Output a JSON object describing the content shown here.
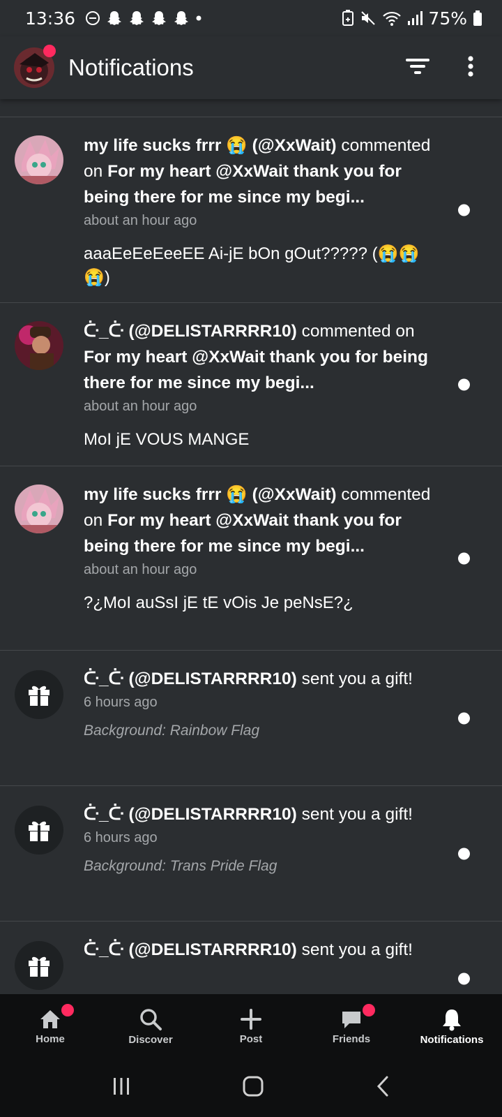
{
  "status_bar": {
    "time": "13:36",
    "battery": "75%",
    "icons": [
      "dnd-icon",
      "snapchat-icon",
      "snapchat-icon",
      "snapchat-icon",
      "snapchat-icon",
      "dot-icon",
      "battery-saver-icon",
      "mute-icon",
      "wifi-icon",
      "signal-icon",
      "battery-icon"
    ]
  },
  "header": {
    "title": "Notifications",
    "filter_icon": "filter-icon",
    "more_icon": "more-vertical-icon"
  },
  "notifications": [
    {
      "type": "comment",
      "user": "my life sucks frrr 😭 (@XxWait)",
      "action": "commented on",
      "target": "For my heart @XxWait thank you for being there for me since my begi...",
      "time": "about an hour ago",
      "content": "aaaEeEeEeeEE Ai-jE bOn gOut????? (😭😭😭)"
    },
    {
      "type": "comment",
      "user": "ᑤ_ᑤ (@DELISTARRRR10)",
      "action": "commented on",
      "target": "For my heart @XxWait thank you for being there for me since my begi...",
      "time": "about an hour ago",
      "content": "MoI jE VOUS MANGE"
    },
    {
      "type": "comment",
      "user": "my life sucks frrr 😭 (@XxWait)",
      "action": "commented on",
      "target": "For my heart @XxWait thank you for being there for me since my begi...",
      "time": "about an hour ago",
      "content": "?¿MoI auSsI jE tE vOis Je peNsE?¿"
    },
    {
      "type": "gift",
      "user": "ᑤ_ᑤ (@DELISTARRRR10)",
      "action": "sent you a gift!",
      "time": "6 hours ago",
      "content": "Background: Rainbow Flag"
    },
    {
      "type": "gift",
      "user": "ᑤ_ᑤ (@DELISTARRRR10)",
      "action": "sent you a gift!",
      "time": "6 hours ago",
      "content": "Background: Trans Pride Flag"
    },
    {
      "type": "gift",
      "user": "ᑤ_ᑤ (@DELISTARRRR10)",
      "action": "sent you a gift!",
      "time": "",
      "content": ""
    }
  ],
  "bottom_nav": [
    {
      "label": "Home",
      "icon": "home-icon",
      "badge": true
    },
    {
      "label": "Discover",
      "icon": "search-icon",
      "badge": false
    },
    {
      "label": "Post",
      "icon": "plus-icon",
      "badge": false
    },
    {
      "label": "Friends",
      "icon": "chat-icon",
      "badge": true
    },
    {
      "label": "Notifications",
      "icon": "bell-icon",
      "badge": false,
      "active": true
    }
  ],
  "colors": {
    "background": "#2b2e31",
    "badge": "#ff2a5f",
    "divider": "#45484b",
    "nav_bg": "#0e0f10"
  }
}
